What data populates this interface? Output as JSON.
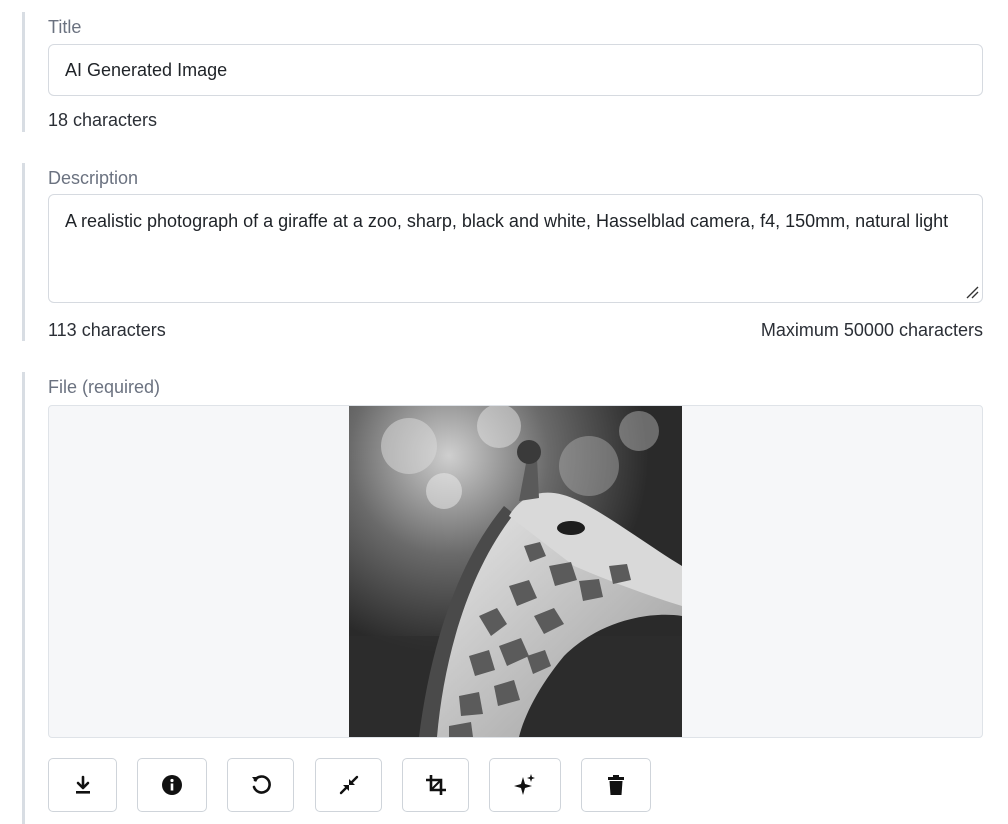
{
  "title_field": {
    "label": "Title",
    "value": "AI Generated Image",
    "char_count": "18 characters"
  },
  "description_field": {
    "label": "Description",
    "value": "A realistic photograph of a giraffe at a zoo, sharp, black and white, Hasselblad camera, f4, 150mm, natural light",
    "char_count": "113 characters",
    "max_hint": "Maximum 50000 characters"
  },
  "file_field": {
    "label": "File (required)",
    "image_subject": "giraffe photo"
  },
  "toolbar": {
    "buttons": [
      {
        "icon": "download-icon"
      },
      {
        "icon": "info-icon"
      },
      {
        "icon": "rotate-icon"
      },
      {
        "icon": "shrink-icon"
      },
      {
        "icon": "crop-icon"
      },
      {
        "icon": "sparkles-icon"
      },
      {
        "icon": "trash-icon"
      }
    ]
  },
  "colors": {
    "border_accent": "#d8dde3",
    "label_text": "#6b7280",
    "preview_bg": "#f6f7f9"
  }
}
